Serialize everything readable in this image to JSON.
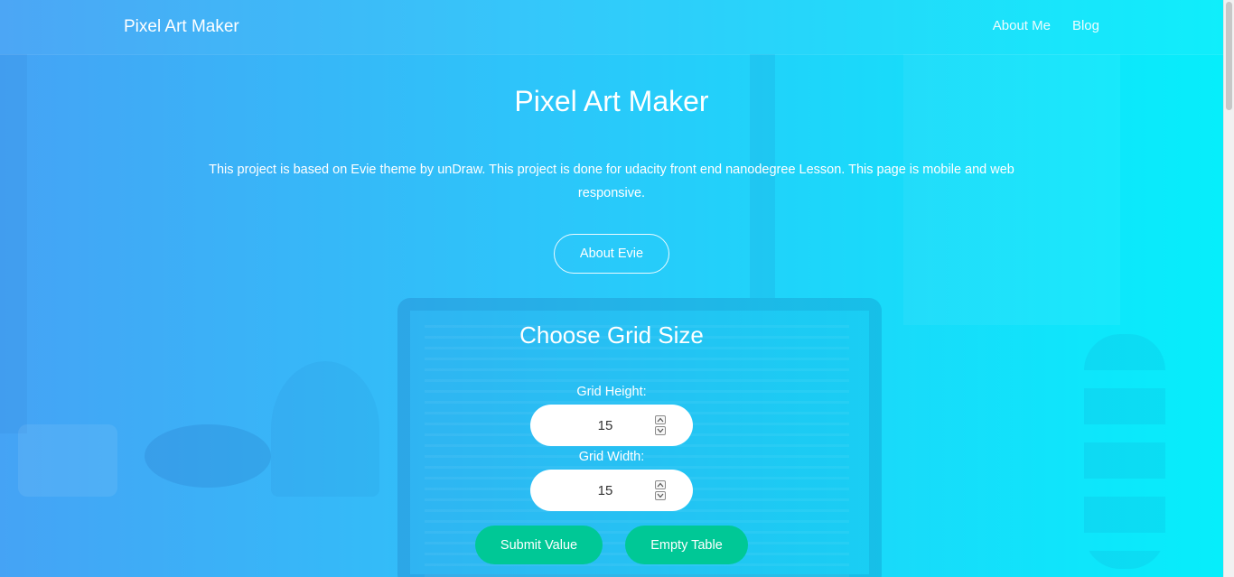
{
  "nav": {
    "brand": "Pixel Art Maker",
    "links": [
      {
        "label": "About Me"
      },
      {
        "label": "Blog"
      }
    ]
  },
  "hero": {
    "title": "Pixel Art Maker",
    "description": "This project is based on Evie theme by unDraw. This project is done for udacity front end nanodegree Lesson. This page is mobile and web responsive.",
    "button_label": "About Evie"
  },
  "grid_form": {
    "title": "Choose Grid Size",
    "height_label": "Grid Height:",
    "height_value": "15",
    "width_label": "Grid Width:",
    "width_value": "15",
    "submit_label": "Submit Value",
    "empty_label": "Empty Table"
  },
  "icons": {
    "stepper_up": "chevron-up-icon",
    "stepper_down": "chevron-down-icon"
  },
  "colors": {
    "gradient_start": "#45a3f5",
    "gradient_end": "#06eefb",
    "accent_button": "#00c896"
  }
}
